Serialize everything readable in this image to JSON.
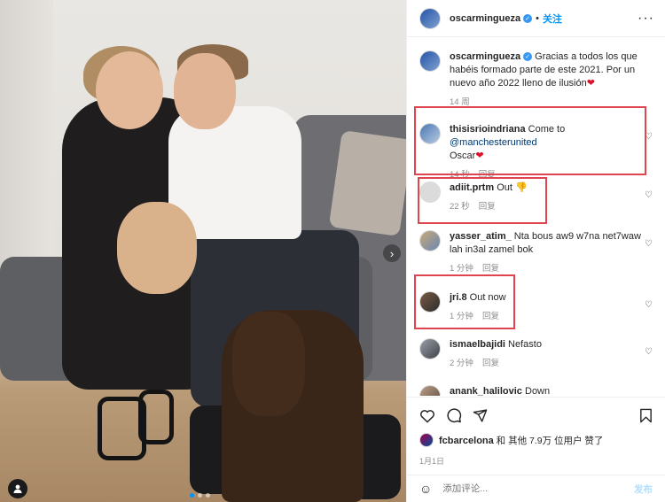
{
  "post": {
    "author": "oscarmingueza",
    "follow_label": "关注",
    "separator": "•",
    "more_icon": "more-horizontal-icon",
    "caption": "Gracias a todos los que habéis formado parte de este 2021. Por un nuevo año 2022 lleno de ilusión",
    "caption_heart": "❤",
    "caption_time": "14 周",
    "image_dots": 3,
    "active_dot": 0
  },
  "comments": [
    {
      "user": "thisisrioindriana",
      "text_prefix": "Come to ",
      "mention": "@manchesterunited",
      "text_suffix": "Oscar",
      "emoji": "❤",
      "time": "14 秒",
      "reply": "回复",
      "highlighted": true
    },
    {
      "user": "adiit.prtm",
      "text_prefix": "Out ",
      "mention": "",
      "text_suffix": "",
      "emoji": "👎",
      "time": "22 秒",
      "reply": "回复",
      "highlighted": true
    },
    {
      "user": "yasser_atim_",
      "text_prefix": "Nta bous aw9 w7na net7waw lah in3al zamel bok",
      "mention": "",
      "text_suffix": "",
      "emoji": "",
      "time": "1 分钟",
      "reply": "回复",
      "highlighted": false
    },
    {
      "user": "jri.8",
      "text_prefix": "Out now",
      "mention": "",
      "text_suffix": "",
      "emoji": "",
      "time": "1 分钟",
      "reply": "回复",
      "highlighted": true
    },
    {
      "user": "ismaelbajidi",
      "text_prefix": "Nefasto",
      "mention": "",
      "text_suffix": "",
      "emoji": "",
      "time": "2 分钟",
      "reply": "回复",
      "highlighted": false
    },
    {
      "user": "anank_halilovic",
      "text_prefix": "Down",
      "mention": "",
      "text_suffix": "",
      "emoji": "",
      "time": "",
      "reply": "",
      "highlighted": false
    }
  ],
  "likes": {
    "user": "fcbarcelona",
    "text": "和 其他 7.9万 位用户 赞了"
  },
  "date": "1月1日",
  "composer": {
    "placeholder": "添加评论...",
    "post_label": "发布"
  },
  "colors": {
    "accent": "#0095f6",
    "highlight_border": "#e0454f",
    "verified": "#3897f0"
  }
}
